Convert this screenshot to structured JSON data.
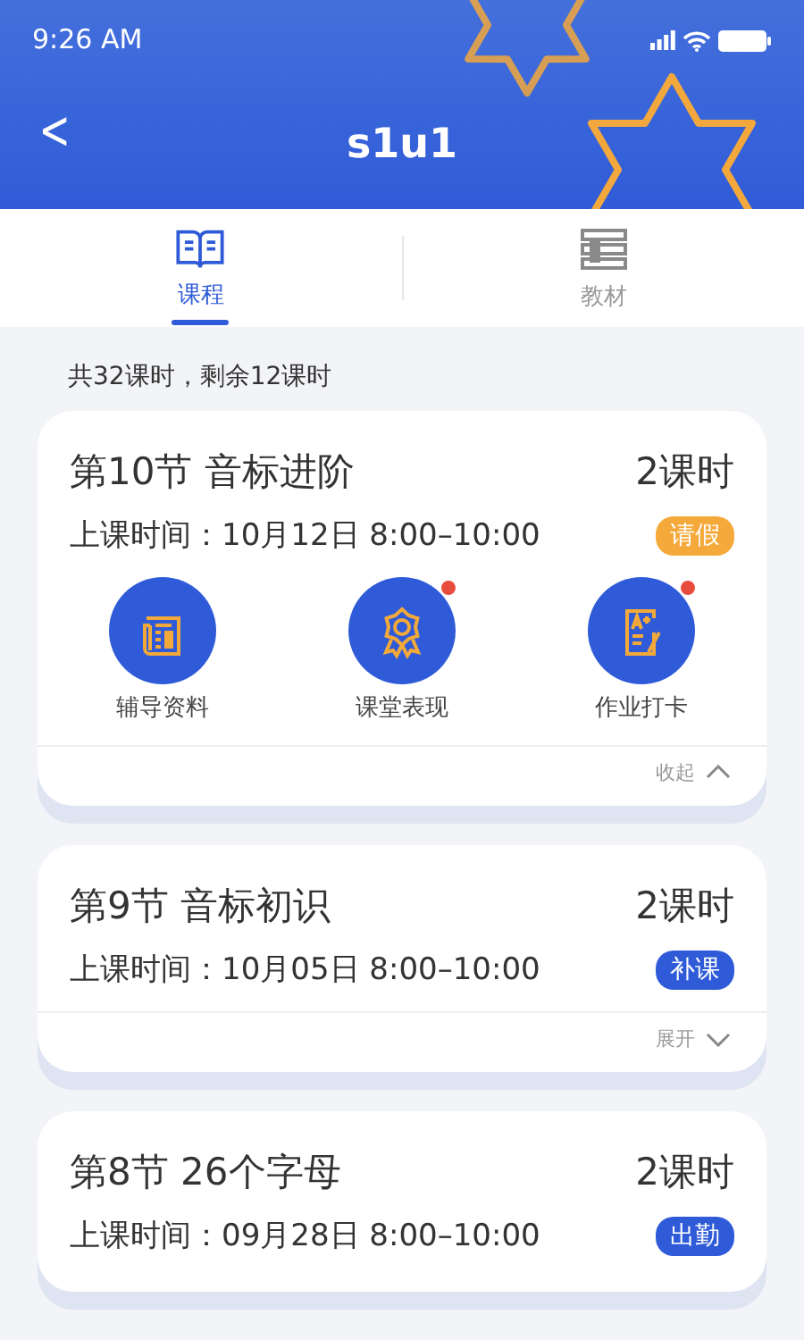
{
  "status_bar": {
    "time": "9:26 AM"
  },
  "header": {
    "back": "<",
    "title": "s1u1"
  },
  "tabs": [
    {
      "label": "课程",
      "selected": true,
      "kind": "book"
    },
    {
      "label": "教材",
      "selected": false,
      "kind": "material"
    }
  ],
  "summary": "共32课时，剩余12课时",
  "lessons": [
    {
      "title": "第10节  音标进阶",
      "hours": "2课时",
      "time": "上课时间：10月12日 8:00–10:00",
      "badge": "请假",
      "color": "#f6a93b",
      "expanded": true,
      "toggle": "收起",
      "actions": [
        {
          "label": "辅导资料",
          "kind": "materials",
          "dot": false
        },
        {
          "label": "课堂表现",
          "kind": "award",
          "dot": true
        },
        {
          "label": "作业打卡",
          "kind": "homework",
          "dot": true
        }
      ]
    },
    {
      "title": "第9节  音标初识",
      "hours": "2课时",
      "time": "上课时间：10月05日 8:00–10:00",
      "badge": "补课",
      "color": "#2f5bd8",
      "expanded": false,
      "toggle": "展开"
    },
    {
      "title": "第8节  26个字母",
      "hours": "2课时",
      "time": "上课时间：09月28日 8:00–10:00",
      "badge": "出勤",
      "color": "#2f5bd8"
    }
  ]
}
